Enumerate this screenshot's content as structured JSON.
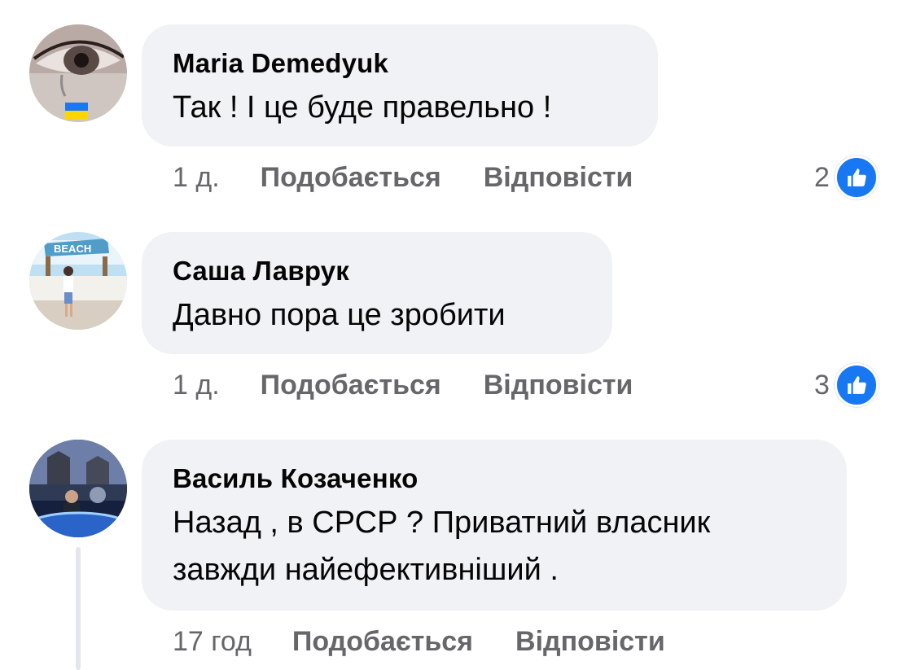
{
  "comments": [
    {
      "author": "Maria Demedyuk",
      "text_lines": [
        "Так ! І це буде правельно !"
      ],
      "time": "1 д.",
      "like_label": "Подобається",
      "reply_label": "Відповісти",
      "reaction_count": "2",
      "avatar_icon": "eye-tear-ukraine-flag"
    },
    {
      "author": "Саша Лаврук",
      "text_lines": [
        "Давно пора це зробити"
      ],
      "time": "1 д.",
      "like_label": "Подобається",
      "reply_label": "Відповісти",
      "reaction_count": "3",
      "avatar_icon": "beach-photo",
      "avatar_sign": "BEACH"
    },
    {
      "author": "Василь Козаченко",
      "text_lines": [
        "Назад , в СРСР ? Приватний власник",
        "завжди найефективніший ."
      ],
      "time": "17 год",
      "like_label": "Подобається",
      "reply_label": "Відповісти",
      "avatar_icon": "city-photo-globe"
    }
  ],
  "colors": {
    "bubble_bg": "#f0f2f5",
    "meta_text": "#65676b",
    "like_blue": "#1877f2"
  }
}
